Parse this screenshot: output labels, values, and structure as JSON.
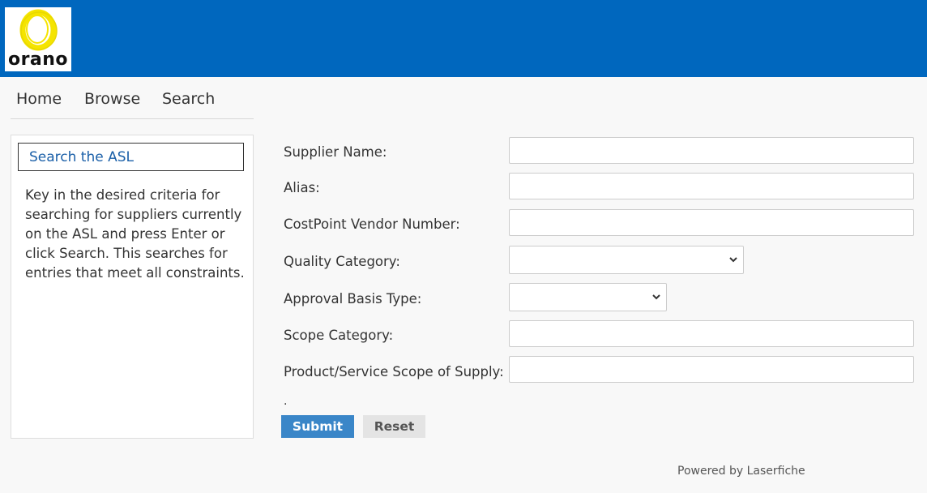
{
  "header": {
    "logo_text": "orano",
    "colors": {
      "bar": "#0067be",
      "logo_ring": "#f5e400"
    }
  },
  "nav": {
    "items": [
      {
        "label": "Home"
      },
      {
        "label": "Browse"
      },
      {
        "label": "Search"
      }
    ]
  },
  "panel": {
    "title": "Search the ASL",
    "description": "Key in the desired criteria for searching for suppliers currently on the ASL and press Enter or click Search. This searches for entries that meet all constraints."
  },
  "form": {
    "supplier_name": {
      "label": "Supplier Name:",
      "value": "",
      "placeholder": ""
    },
    "alias": {
      "label": "Alias:",
      "value": "",
      "placeholder": ""
    },
    "costpoint_vendor_number": {
      "label": "CostPoint Vendor Number:",
      "value": "",
      "placeholder": ""
    },
    "quality_category": {
      "label": "Quality Category:",
      "selected": ""
    },
    "approval_basis_type": {
      "label": "Approval Basis Type:",
      "selected": ""
    },
    "scope_category": {
      "label": "Scope Category:",
      "value": "",
      "placeholder": ""
    },
    "product_service_scope": {
      "label": "Product/Service Scope of Supply:",
      "value": "",
      "placeholder": ""
    },
    "dot": ".",
    "submit_label": "Submit",
    "reset_label": "Reset"
  },
  "footer": {
    "text": "Powered by Laserfiche"
  }
}
